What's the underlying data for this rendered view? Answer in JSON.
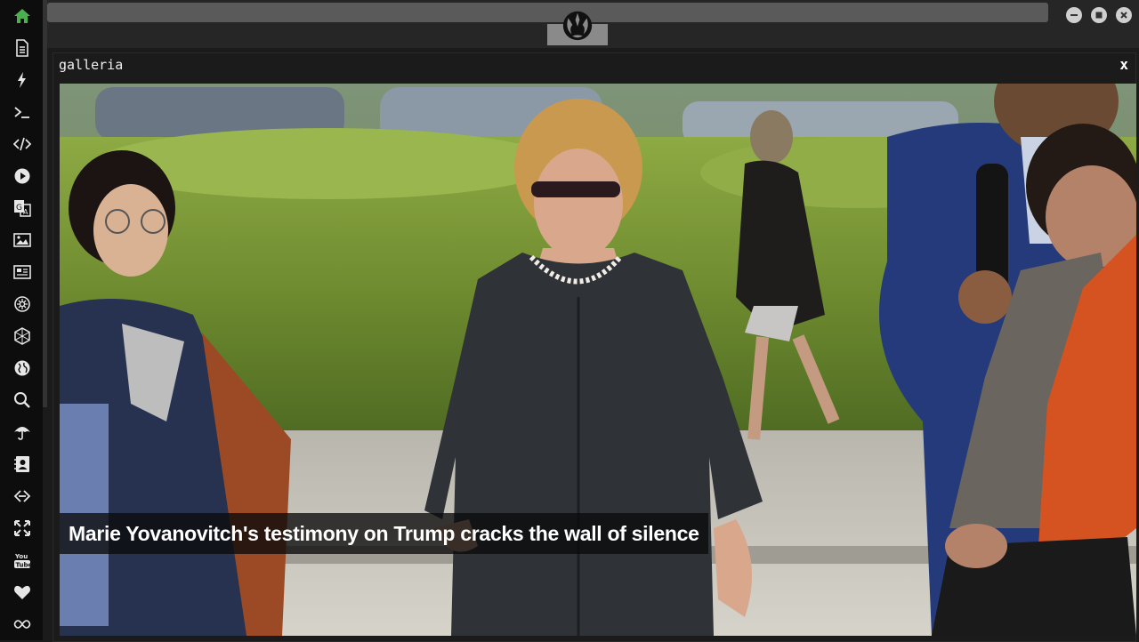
{
  "app": {
    "panel_title": "galleria",
    "close_label": "x"
  },
  "sidebar": {
    "items": [
      {
        "icon": "home-icon",
        "active": true
      },
      {
        "icon": "document-icon"
      },
      {
        "icon": "lightning-icon"
      },
      {
        "icon": "terminal-icon"
      },
      {
        "icon": "code-icon"
      },
      {
        "icon": "play-icon"
      },
      {
        "icon": "translate-icon"
      },
      {
        "icon": "image-icon"
      },
      {
        "icon": "newspaper-icon"
      },
      {
        "icon": "settings-cog-icon"
      },
      {
        "icon": "hexagon-icon"
      },
      {
        "icon": "globe-icon"
      },
      {
        "icon": "search-icon"
      },
      {
        "icon": "umbrella-icon"
      },
      {
        "icon": "contacts-icon"
      },
      {
        "icon": "link-icon"
      },
      {
        "icon": "expand-icon"
      },
      {
        "icon": "youtube-icon"
      },
      {
        "icon": "heart-icon"
      },
      {
        "icon": "infinity-icon"
      }
    ]
  },
  "window": {
    "buttons": [
      "minimize-icon",
      "maximize-icon",
      "close-icon"
    ],
    "logo": "rebel-alliance-logo-icon"
  },
  "gallery": {
    "caption": "Marie Yovanovitch's testimony on Trump cracks the wall of silence"
  },
  "colors": {
    "active_icon": "#4caf50",
    "icon": "#e6e6e6",
    "background": "#1b1b1b"
  }
}
